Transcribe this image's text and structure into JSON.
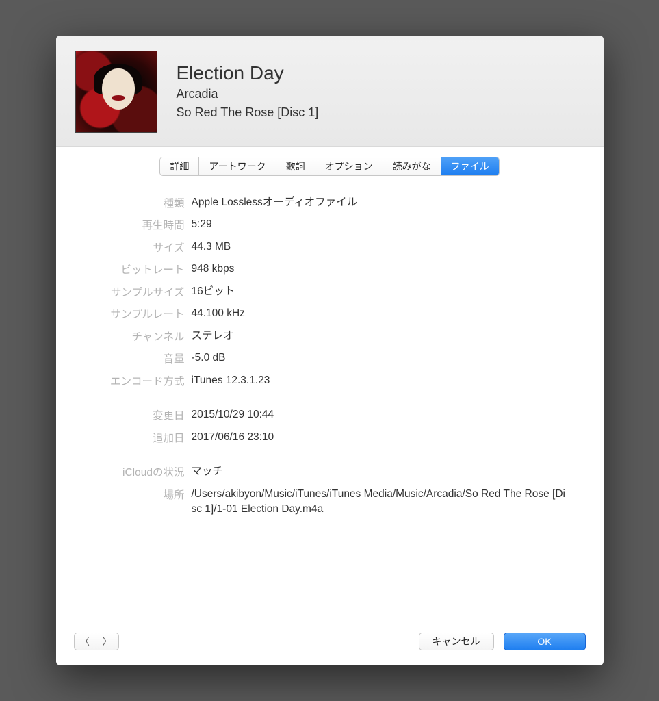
{
  "header": {
    "title": "Election Day",
    "artist": "Arcadia",
    "album": "So Red The Rose [Disc 1]"
  },
  "tabs": [
    {
      "id": "details",
      "label": "詳細"
    },
    {
      "id": "artwork",
      "label": "アートワーク"
    },
    {
      "id": "lyrics",
      "label": "歌詞"
    },
    {
      "id": "options",
      "label": "オプション"
    },
    {
      "id": "yomi",
      "label": "読みがな"
    },
    {
      "id": "file",
      "label": "ファイル",
      "selected": true
    }
  ],
  "fields": {
    "kind_label": "種類",
    "kind_value": "Apple Losslessオーディオファイル",
    "duration_label": "再生時間",
    "duration_value": "5:29",
    "size_label": "サイズ",
    "size_value": "44.3 MB",
    "bitrate_label": "ビットレート",
    "bitrate_value": "948 kbps",
    "samplesize_label": "サンプルサイズ",
    "samplesize_value": "16ビット",
    "samplerate_label": "サンプルレート",
    "samplerate_value": "44.100 kHz",
    "channels_label": "チャンネル",
    "channels_value": "ステレオ",
    "volume_label": "音量",
    "volume_value": "-5.0 dB",
    "encoder_label": "エンコード方式",
    "encoder_value": "iTunes 12.3.1.23",
    "modified_label": "変更日",
    "modified_value": "2015/10/29 10:44",
    "added_label": "追加日",
    "added_value": "2017/06/16 23:10",
    "icloud_label": "iCloudの状況",
    "icloud_value": "マッチ",
    "location_label": "場所",
    "location_value": "/Users/akibyon/Music/iTunes/iTunes Media/Music/Arcadia/So Red The Rose [Disc 1]/1-01 Election Day.m4a"
  },
  "footer": {
    "cancel": "キャンセル",
    "ok": "OK"
  }
}
